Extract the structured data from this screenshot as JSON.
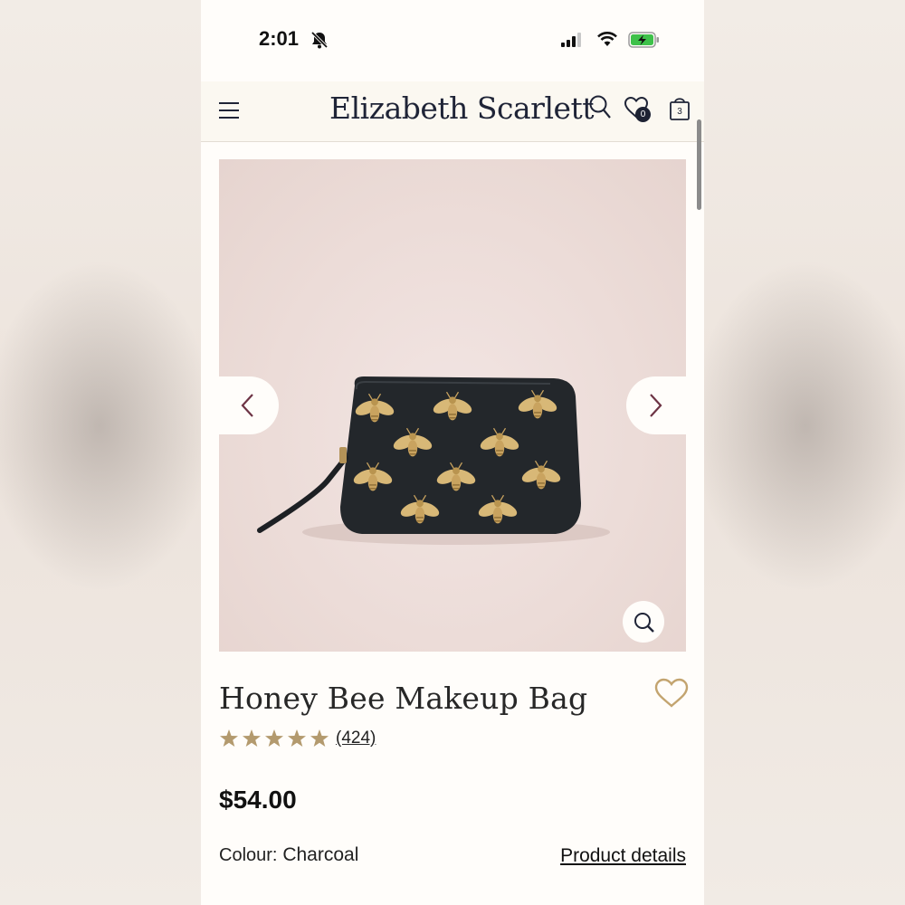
{
  "status_bar": {
    "time": "2:01",
    "icons": [
      "bell-slash-icon",
      "signal-icon",
      "wifi-icon",
      "battery-charging-icon"
    ]
  },
  "header": {
    "logo": "Elizabeth Scarlett",
    "wishlist_count": "0",
    "bag_count": "3",
    "icons": [
      "menu-icon",
      "search-icon",
      "wishlist-heart-icon",
      "shopping-bag-icon"
    ]
  },
  "gallery": {
    "icons": [
      "chevron-left-icon",
      "chevron-right-icon",
      "zoom-icon"
    ]
  },
  "product": {
    "title": "Honey Bee Makeup Bag",
    "rating": 5,
    "review_count": "(424)",
    "price": "$54.00",
    "colour_label": "Colour:",
    "colour_value": "Charcoal",
    "details_link": "Product details"
  },
  "colors": {
    "brand_navy": "#1f2437",
    "star_gold": "#b39a6e",
    "heart_gold": "#c3a46f",
    "arrow_maroon": "#6d3344"
  }
}
